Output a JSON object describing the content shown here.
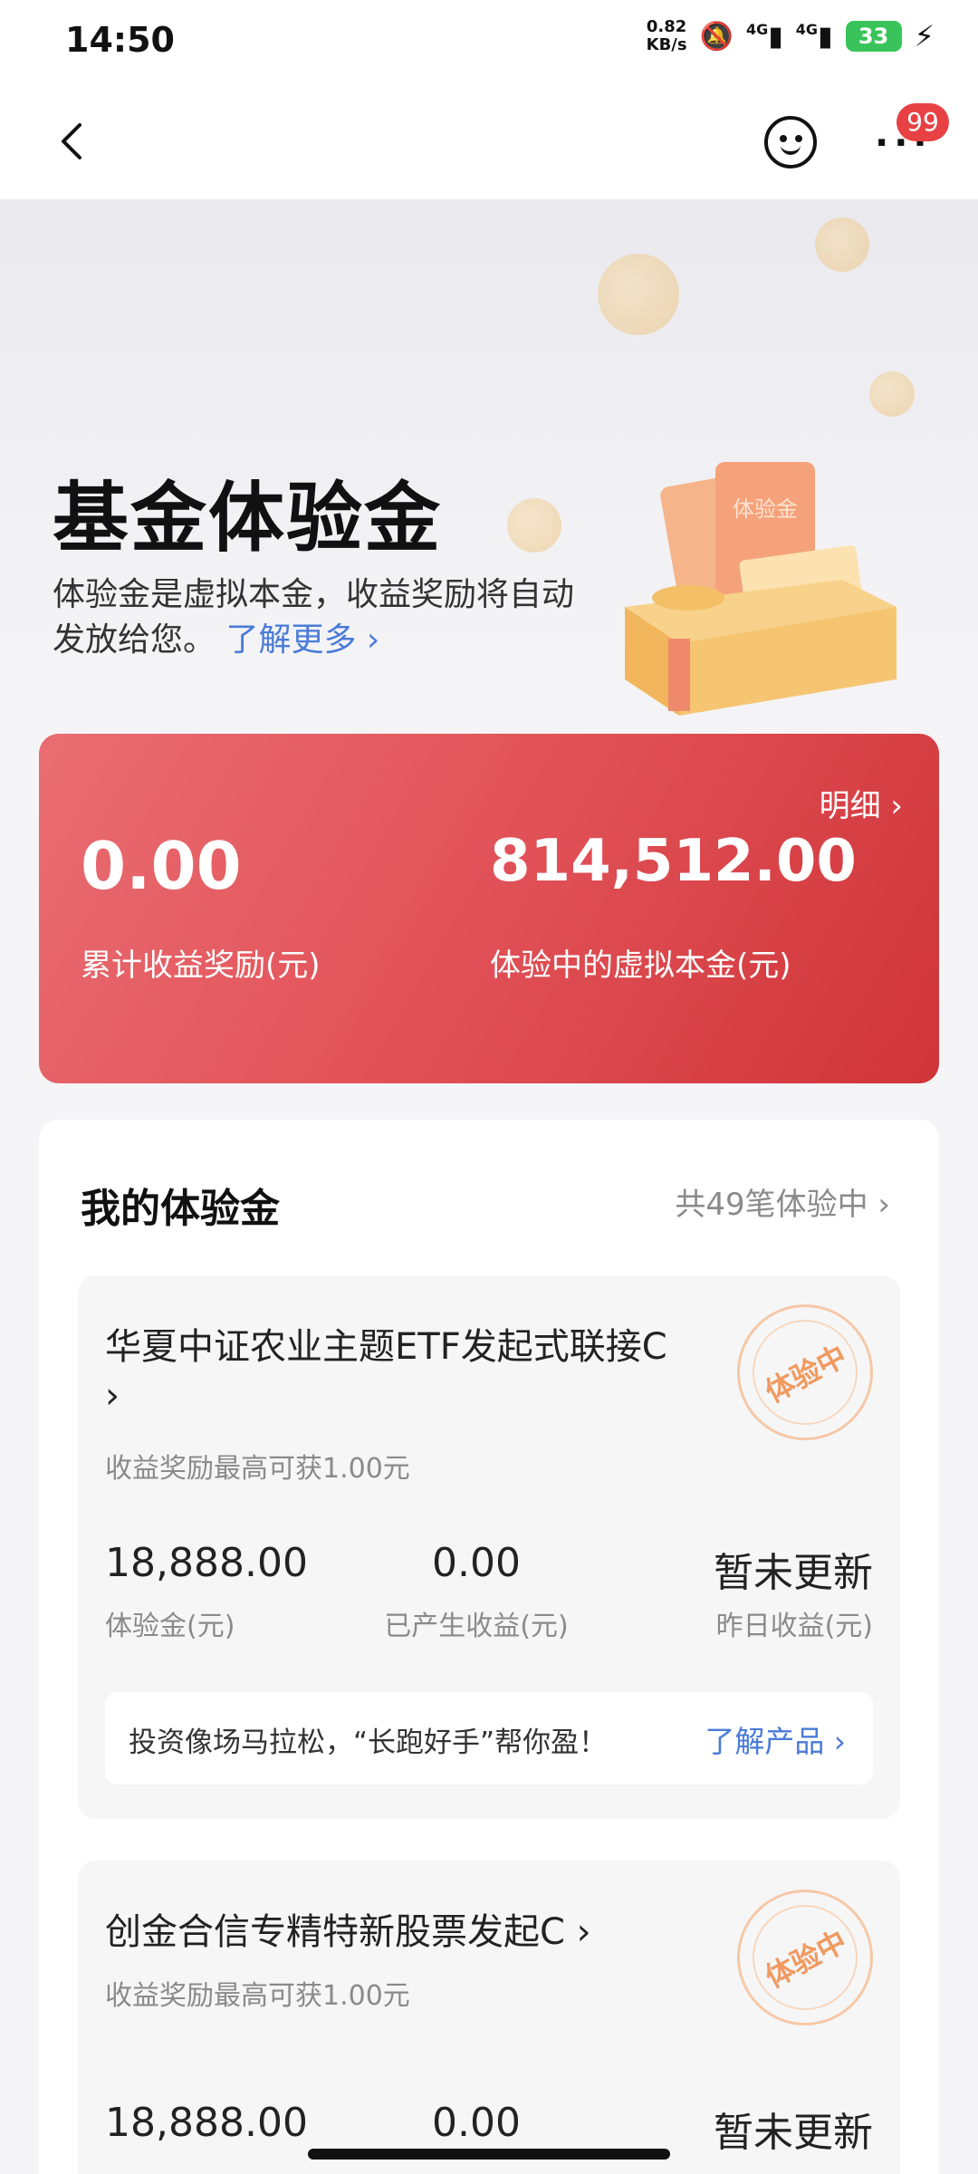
{
  "status_bar": {
    "time": "14:50",
    "net_speed_value": "0.82",
    "net_speed_unit": "KB/s",
    "signal1": "4G",
    "signal2": "4G",
    "battery": "33"
  },
  "nav": {
    "badge": "99",
    "icons": [
      "back-icon",
      "smile-icon",
      "more-icon"
    ]
  },
  "hero": {
    "title": "基金体验金",
    "subtitle": "体验金是虚拟本金，收益奖励将自动发放给您。",
    "learn_more": "了解更多 ›",
    "gift_label": "体验金"
  },
  "summary": {
    "detail_link": "明细 ›",
    "cumulative_value": "0.00",
    "cumulative_label": "累计收益奖励(元)",
    "virtual_principal_value": "814,512.00",
    "virtual_principal_label": "体验中的虚拟本金(元)"
  },
  "my_section": {
    "title": "我的体验金",
    "count_link": "共49笔体验中 ›",
    "funds": [
      {
        "name": "华夏中证农业主题ETF发起式联接C ›",
        "hint": "收益奖励最高可获1.00元",
        "stamp": "体验中",
        "experience_value": "18,888.00",
        "experience_label": "体验金(元)",
        "earned_value": "0.00",
        "earned_label": "已产生收益(元)",
        "yesterday_value": "暂未更新",
        "yesterday_label": "昨日收益(元)",
        "promo_text": "投资像场马拉松，“长跑好手”帮你盈！",
        "promo_link": "了解产品 ›"
      },
      {
        "name": "创金合信专精特新股票发起C ›",
        "hint": "收益奖励最高可获1.00元",
        "stamp": "体验中",
        "experience_value": "18,888.00",
        "earned_value": "0.00",
        "yesterday_value": "暂未更新"
      }
    ]
  },
  "colors": {
    "accent_red": "#e2545a",
    "link_blue": "#4a7bd8",
    "stamp_orange": "#f09a60"
  }
}
